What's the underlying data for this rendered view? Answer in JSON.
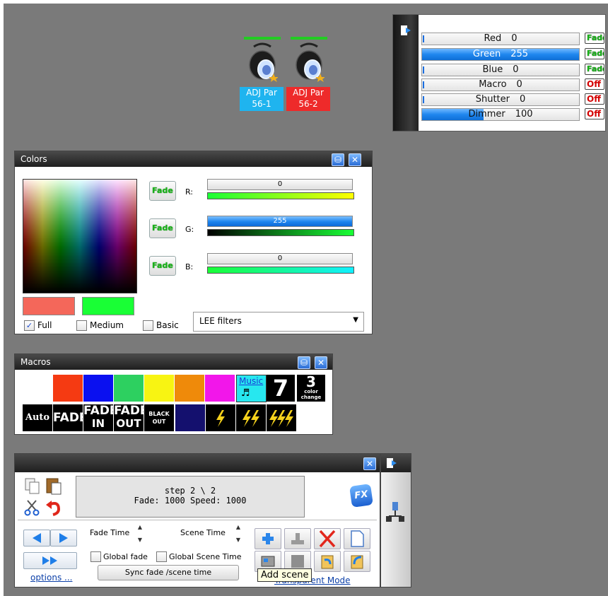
{
  "fixtures": [
    {
      "line1": "ADJ Par",
      "line2": "56-1",
      "color": "#1fb4ef"
    },
    {
      "line1": "ADJ Par",
      "line2": "56-2",
      "color": "#ee2a2a"
    }
  ],
  "channels": [
    {
      "name": "Red",
      "value": "0",
      "level": 0,
      "badge": "Fade"
    },
    {
      "name": "Green",
      "value": "255",
      "level": 1.0,
      "badge": "Fade"
    },
    {
      "name": "Blue",
      "value": "0",
      "level": 0,
      "badge": "Fade"
    },
    {
      "name": "Macro",
      "value": "0",
      "level": 0,
      "badge": "Off"
    },
    {
      "name": "Shutter",
      "value": "0",
      "level": 0,
      "badge": "Off"
    },
    {
      "name": "Dimmer",
      "value": "100",
      "level": 0.39,
      "badge": "Off"
    }
  ],
  "colors_window": {
    "title": "Colors",
    "fade_label": "Fade",
    "rgb": [
      {
        "label": "R:",
        "value": "0",
        "level": 0
      },
      {
        "label": "G:",
        "value": "255",
        "level": 1.0
      },
      {
        "label": "B:",
        "value": "0",
        "level": 0
      }
    ],
    "swatches": [
      "#f4675a",
      "#19ff35"
    ],
    "filters": [
      {
        "label": "Full",
        "checked": true
      },
      {
        "label": "Medium",
        "checked": false
      },
      {
        "label": "Basic",
        "checked": false
      }
    ],
    "dropdown_value": "LEE filters"
  },
  "macros_window": {
    "title": "Macros",
    "colors": [
      "#ffffff",
      "#f53a12",
      "#0a10f0",
      "#2dd060",
      "#f8f412",
      "#ef8a0a",
      "#f216ea"
    ],
    "music_label": "Music",
    "seven_label": "7",
    "three_label": "3",
    "three_sub1": "color",
    "three_sub2": "change",
    "row2": [
      {
        "line1": "Auto",
        "line2": ""
      },
      {
        "line1": "FADE",
        "line2": ""
      },
      {
        "line1": "FADE",
        "line2": "IN"
      },
      {
        "line1": "FADE",
        "line2": "OUT"
      },
      {
        "line1": "BLACK",
        "line2": "OUT"
      }
    ],
    "dark_blue": "#14106e"
  },
  "scene_window": {
    "step_line1": "step 2 \\ 2",
    "step_line2": "Fade: 1000  Speed: 1000",
    "fx_label": "FX",
    "fade_time_label": "Fade Time",
    "scene_time_label": "Scene Time",
    "global_fade_label": "Global fade",
    "global_scene_time_label": "Global Scene Time",
    "sync_label": "Sync fade /scene time",
    "options_label": "options ...",
    "tooltip": "Add scene",
    "transparent_mode_label": "Transparent Mode"
  }
}
